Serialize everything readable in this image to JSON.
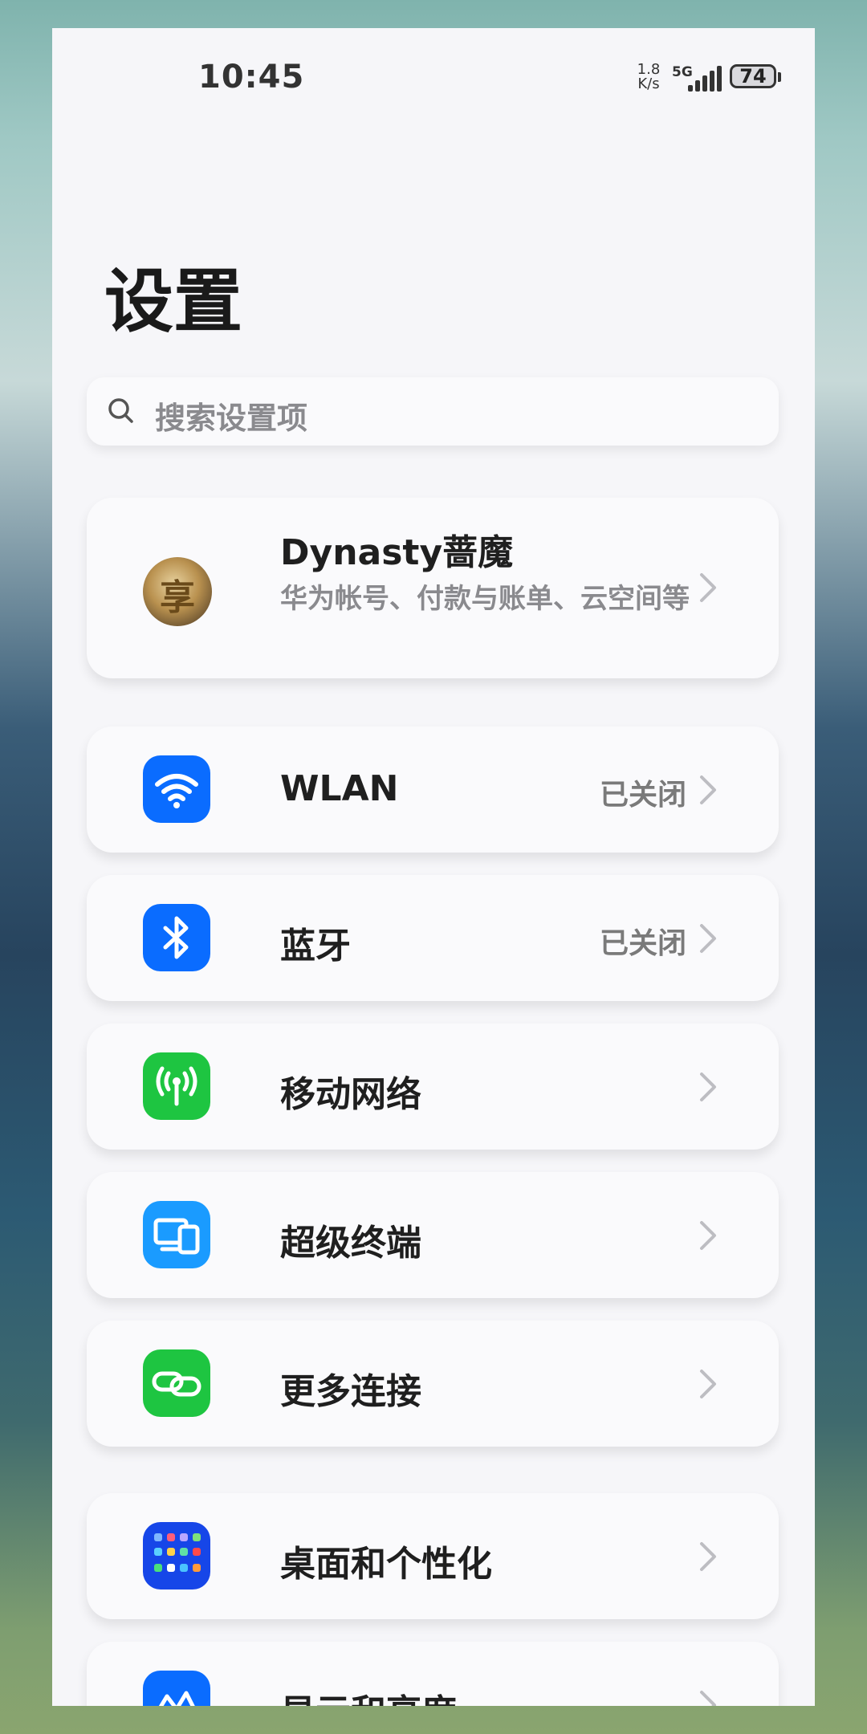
{
  "status_bar": {
    "time": "10:45",
    "net_speed_value": "1.8",
    "net_speed_unit": "K/s",
    "network_type": "5G",
    "battery": "74"
  },
  "page": {
    "title": "设置"
  },
  "search": {
    "placeholder": "搜索设置项"
  },
  "account": {
    "name": "Dynasty蔷魔",
    "subtitle": "华为帐号、付款与账单、云空间等"
  },
  "connectivity": [
    {
      "label": "WLAN",
      "status": "已关闭",
      "icon": "wifi-icon",
      "color": "#0a6cff"
    },
    {
      "label": "蓝牙",
      "status": "已关闭",
      "icon": "bluetooth-icon",
      "color": "#0a6cff"
    },
    {
      "label": "移动网络",
      "status": "",
      "icon": "mobile-network-icon",
      "color": "#1ec541"
    },
    {
      "label": "超级终端",
      "status": "",
      "icon": "super-device-icon",
      "color": "#1a9bff"
    },
    {
      "label": "更多连接",
      "status": "",
      "icon": "more-connections-icon",
      "color": "#1ec541"
    }
  ],
  "personal": [
    {
      "label": "桌面和个性化",
      "icon": "home-screen-icon",
      "color": "#1646e8"
    },
    {
      "label": "显示和亮度",
      "icon": "display-icon",
      "color": "#0a6cff"
    }
  ]
}
